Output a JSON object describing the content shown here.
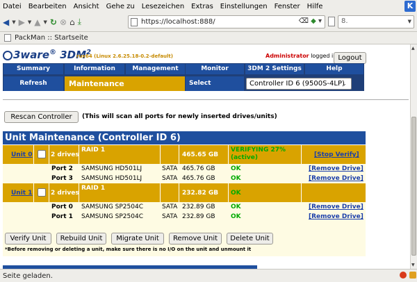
{
  "browser": {
    "menu": [
      "Datei",
      "Bearbeiten",
      "Ansicht",
      "Gehe zu",
      "Lesezeichen",
      "Extras",
      "Einstellungen",
      "Fenster",
      "Hilfe"
    ],
    "url": "https://localhost:888/",
    "bookmark": "PackMan :: Startseite",
    "status": "Seite geladen."
  },
  "header": {
    "logo_brand": "3ware",
    "logo_product": "3DM",
    "logo_version": "2",
    "system_info": "rux64 (Linux 2.6.25.18-0.2-default)",
    "user": "Administrator",
    "logged_in_text": "logged in",
    "logout_label": "Logout"
  },
  "nav": {
    "tabs": [
      "Summary",
      "Information",
      "Management",
      "Monitor",
      "3DM 2 Settings",
      "Help"
    ],
    "refresh_label": "Refresh",
    "current_page": "Maintenance",
    "select_controller_label": "Select Controller",
    "selected_controller": "Controller ID 6 (9500S-4LP)"
  },
  "rescan": {
    "button_label": "Rescan Controller",
    "note": "(This will scan all ports for newly inserted drives/units)"
  },
  "maintenance": {
    "title": "Unit Maintenance (Controller ID 6)",
    "units": [
      {
        "label": "Unit 0",
        "drives": "2 drives",
        "raid": "RAID 1",
        "size": "465.65 GB",
        "status_line1": "VERIFYING 27%",
        "status_line2": "(active)",
        "verify_progress": 27,
        "action": "[Stop Verify]",
        "ports": [
          {
            "port": "Port 2",
            "model": "SAMSUNG HD501LJ",
            "iface": "SATA",
            "size": "465.76 GB",
            "status": "OK",
            "action": "[Remove Drive]"
          },
          {
            "port": "Port 3",
            "model": "SAMSUNG HD501LJ",
            "iface": "SATA",
            "size": "465.76 GB",
            "status": "OK",
            "action": "[Remove Drive]"
          }
        ]
      },
      {
        "label": "Unit 1",
        "drives": "2 drives",
        "raid": "RAID 1",
        "size": "232.82 GB",
        "status_line1": "OK",
        "status_line2": "",
        "action": "",
        "ports": [
          {
            "port": "Port 0",
            "model": "SAMSUNG SP2504C",
            "iface": "SATA",
            "size": "232.89 GB",
            "status": "OK",
            "action": "[Remove Drive]"
          },
          {
            "port": "Port 1",
            "model": "SAMSUNG SP2504C",
            "iface": "SATA",
            "size": "232.89 GB",
            "status": "OK",
            "action": "[Remove Drive]"
          }
        ]
      }
    ],
    "buttons": [
      "Verify Unit",
      "Rebuild Unit",
      "Migrate Unit",
      "Remove Unit",
      "Delete Unit"
    ],
    "warning": "*Before removing or deleting a unit, make sure there is no I/O on the unit and unmount it"
  },
  "colors": {
    "nav_blue": "#1f4f9e",
    "gold": "#d9a300",
    "status_green": "#00aa00",
    "link_blue": "#1b3faa",
    "admin_red": "#cc0000"
  }
}
